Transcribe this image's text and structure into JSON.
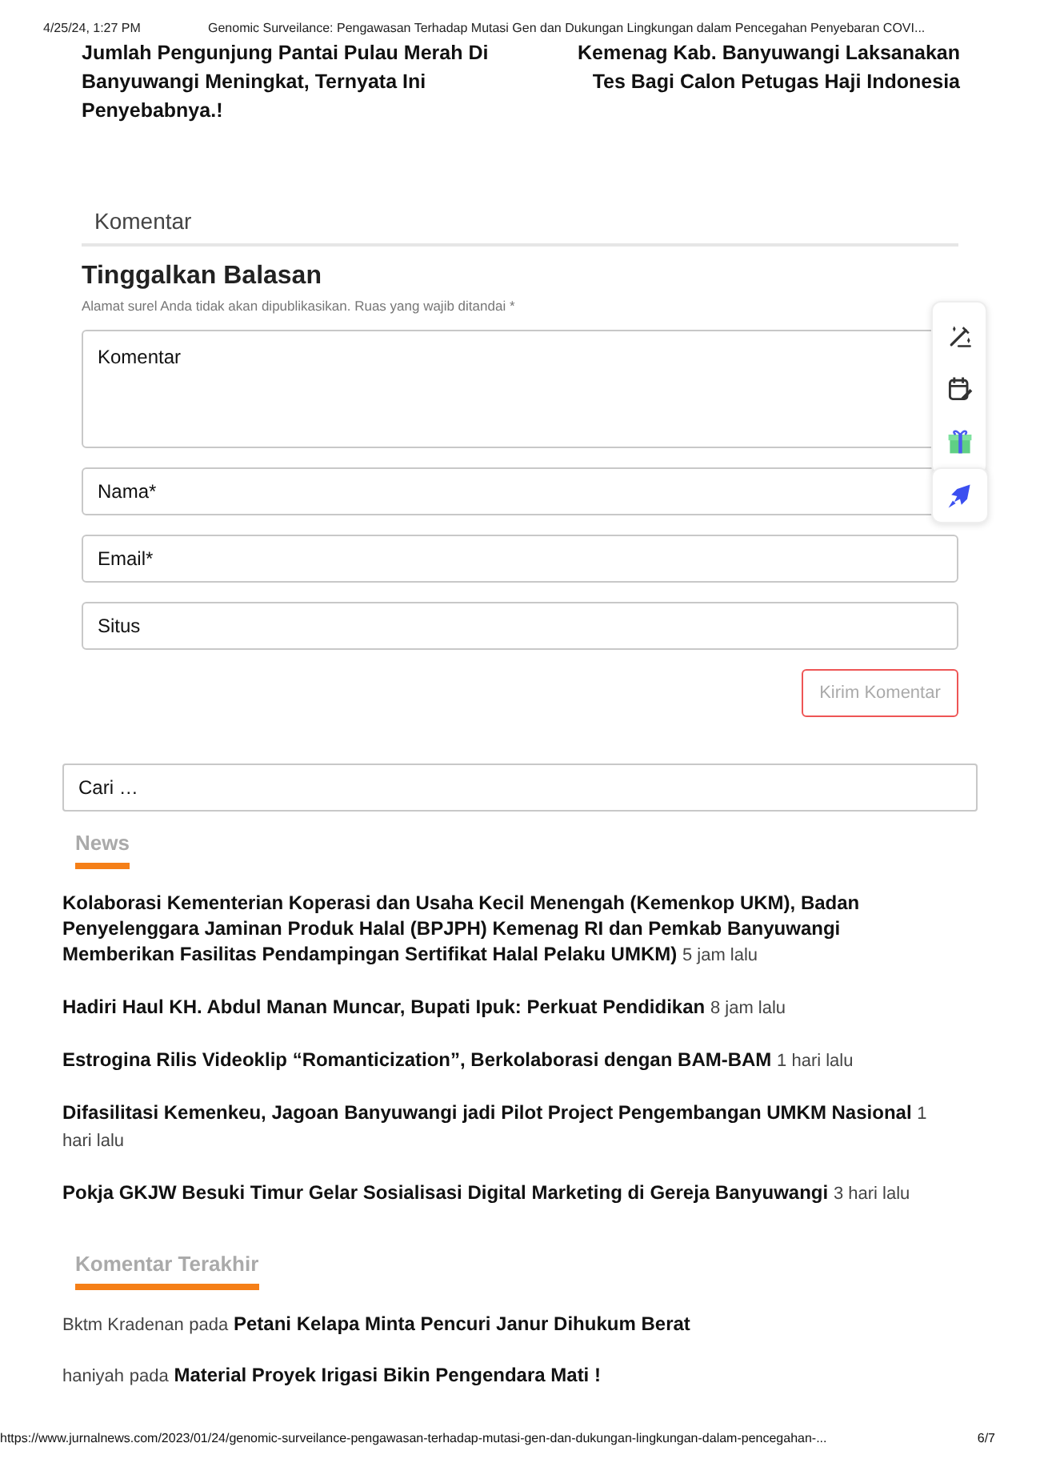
{
  "print_header": {
    "date": "4/25/24, 1:27 PM",
    "title": "Genomic Surveilance: Pengawasan Terhadap Mutasi Gen dan Dukungan Lingkungan dalam Pencegahan Penyebaran COVI..."
  },
  "post_nav": {
    "previous": "Jumlah Pengunjung Pantai Pulau Merah Di Banyuwangi Meningkat, Ternyata Ini Penyebabnya.!",
    "next": "Kemenag Kab. Banyuwangi Laksanakan Tes Bagi Calon Petugas Haji Indonesia"
  },
  "comments_tab": "Komentar",
  "reply_form": {
    "title": "Tinggalkan Balasan",
    "note": "Alamat surel Anda tidak akan dipublikasikan. Ruas yang wajib ditandai *",
    "fields": [
      {
        "kind": "textarea",
        "placeholder": "Komentar"
      },
      {
        "kind": "input",
        "placeholder": "Nama*"
      },
      {
        "kind": "input",
        "placeholder": "Email*"
      },
      {
        "kind": "input",
        "placeholder": "Situs"
      }
    ],
    "submit": "Kirim Komentar"
  },
  "search": {
    "placeholder": "Cari …"
  },
  "news": {
    "title": "News",
    "items": [
      {
        "title": "Kolaborasi Kementerian Koperasi dan Usaha Kecil Menengah (Kemenkop UKM), Badan Penyelenggara Jaminan Produk Halal (BPJPH) Kemenag RI dan Pemkab Banyuwangi Memberikan Fasilitas Pendampingan Sertifikat Halal Pelaku UMKM)",
        "time": "5 jam lalu"
      },
      {
        "title": "Hadiri Haul KH. Abdul Manan Muncar, Bupati Ipuk: Perkuat Pendidikan",
        "time": "8 jam lalu"
      },
      {
        "title": "Estrogina Rilis Videoklip “Romanticization”, Berkolaborasi dengan BAM-BAM",
        "time": "1 hari lalu"
      },
      {
        "title": "Difasilitasi Kemenkeu, Jagoan Banyuwangi jadi Pilot Project Pengembangan UMKM Nasional",
        "time": "1 hari lalu"
      },
      {
        "title": "Pokja GKJW Besuki Timur Gelar Sosialisasi Digital Marketing di Gereja Banyuwangi",
        "time": "3 hari lalu"
      }
    ]
  },
  "recent_comments": {
    "title": "Komentar Terakhir",
    "items": [
      {
        "author": "Bktm Kradenan",
        "connector": "pada",
        "post": "Petani Kelapa Minta Pencuri Janur Dihukum Berat"
      },
      {
        "author": "haniyah",
        "connector": "pada",
        "post": "Material Proyek Irigasi Bikin Pengendara Mati !"
      }
    ]
  },
  "print_footer": {
    "url": "https://www.jurnalnews.com/2023/01/24/genomic-surveilance-pengawasan-terhadap-mutasi-gen-dan-dukungan-lingkungan-dalam-pencegahan-...",
    "page": "6/7"
  }
}
